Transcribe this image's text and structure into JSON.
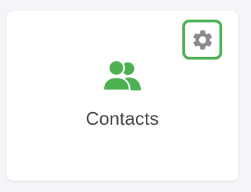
{
  "card": {
    "title": "Contacts",
    "icon": "people-icon",
    "settings_icon": "gear-icon"
  },
  "colors": {
    "accent": "#4caf50",
    "icon_green": "#4caf50",
    "gear_gray": "#8a8a8a",
    "text": "#3f3f46",
    "background": "#f4f5f8",
    "card": "#ffffff"
  }
}
